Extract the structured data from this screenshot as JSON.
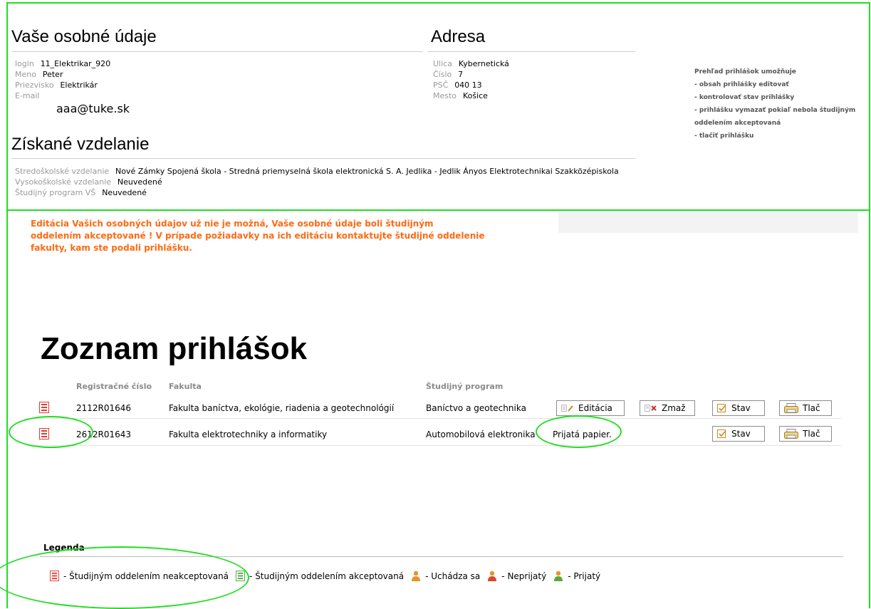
{
  "personal": {
    "title": "Vaše osobné údaje",
    "fields": [
      {
        "label": "login",
        "value": "11_Elektrikar_920"
      },
      {
        "label": "Meno",
        "value": "Peter"
      },
      {
        "label": "Priezvisko",
        "value": "Elektrikár"
      },
      {
        "label": "E-mail",
        "value": "aaa@tuke.sk"
      }
    ]
  },
  "address": {
    "title": "Adresa",
    "fields": [
      {
        "label": "Ulica",
        "value": "Kybernetická"
      },
      {
        "label": "Číslo",
        "value": "7"
      },
      {
        "label": "PSČ",
        "value": "040 13"
      },
      {
        "label": "Mesto",
        "value": "Košice"
      }
    ]
  },
  "education": {
    "title": "Získané vzdelanie",
    "fields": [
      {
        "label": "Stredoškolské vzdelanie",
        "value": "Nové Zámky Spojená škola - Stredná priemyselná škola elektronická S. A. Jedlika - Jedlik Ányos Elektrotechnikai Szakközépiskola"
      },
      {
        "label": "Vysokoškolské vzdelanie",
        "value": "Neuvedené"
      },
      {
        "label": "Študijný program VŠ",
        "value": "Neuvedené"
      }
    ]
  },
  "help": {
    "lines": [
      "Prehľad prihlášok umožňuje",
      "- obsah prihlášky editovať",
      "- kontrolovať stav prihlášky",
      "- prihlášku vymazať pokiaľ nebola študijným",
      "oddelením akceptovaná",
      "- tlačiť prihlášku"
    ]
  },
  "warning": {
    "lines": [
      "Editácia Vašich osobných údajov už nie je možná, Vaše osobné údaje boli študijným",
      "oddelením akceptované ! V prípade požiadavky na ich editáciu kontaktujte študijné oddelenie",
      "fakulty, kam ste podali prihlášku."
    ]
  },
  "applications": {
    "title": "Zoznam prihlášok",
    "headers": [
      "Registračné číslo",
      "Fakulta",
      "Študijný program"
    ],
    "rows": [
      {
        "reg": "2112R01646",
        "faculty": "Fakulta baníctva, ekológie, riadenia a geotechnológií",
        "program": "Baníctvo a geotechnika",
        "edit_label": "Editácia",
        "delete_label": "Zmaž",
        "status_label": "Stav",
        "print_label": "Tlač",
        "status_text": ""
      },
      {
        "reg": "2612R01643",
        "faculty": "Fakulta elektrotechniky a informatiky",
        "program": "Automobilová elektronika",
        "edit_label": "",
        "delete_label": "",
        "status_label": "Stav",
        "print_label": "Tlač",
        "status_text": "Prijatá papier."
      }
    ]
  },
  "legend": {
    "title": "Legenda",
    "items": [
      {
        "icon": "document-red-icon",
        "text": "- Študijným oddelením neakceptovaná"
      },
      {
        "icon": "document-green-icon",
        "text": "- Študijným oddelením akceptovaná"
      },
      {
        "icon": "person-orange-icon",
        "text": "- Uchádza sa"
      },
      {
        "icon": "person-red-icon",
        "text": "- Neprijatý"
      },
      {
        "icon": "person-green-icon",
        "text": "- Prijatý"
      }
    ]
  },
  "colors": {
    "annotation": "#22dd22",
    "warning": "#ff6a13",
    "doc_red": "#e23b2e",
    "doc_green": "#4aa83a"
  }
}
